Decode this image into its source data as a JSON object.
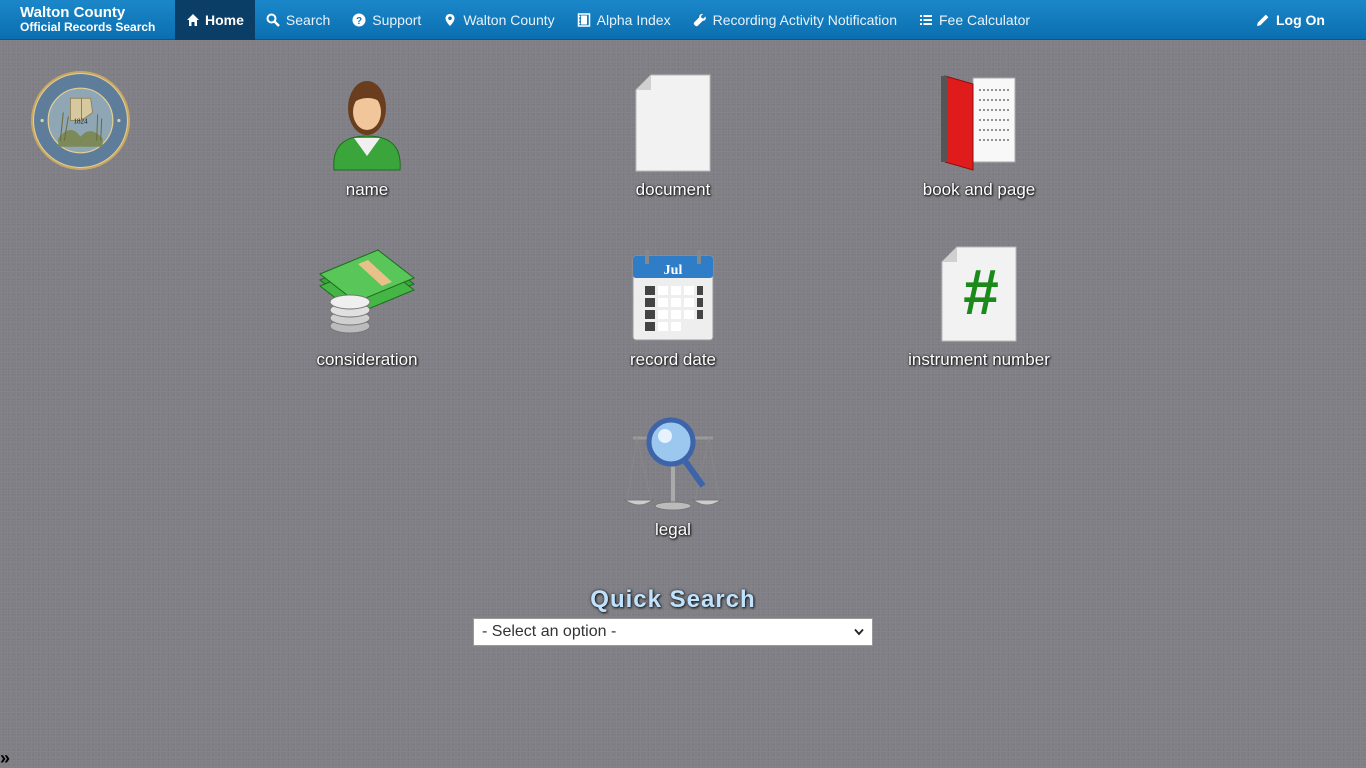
{
  "brand": {
    "line1": "Walton County",
    "line2": "Official Records Search"
  },
  "nav": {
    "home": "Home",
    "search": "Search",
    "support": "Support",
    "county": "Walton County",
    "alpha": "Alpha Index",
    "recording": "Recording Activity Notification",
    "fee": "Fee Calculator",
    "logon": "Log On"
  },
  "seal": {
    "text_top": "Clerk of Courts & County Comptroller",
    "year": "1824",
    "text_bottom": "Walton County, Florida"
  },
  "tiles": {
    "name": "name",
    "document": "document",
    "book_page": "book and page",
    "consideration": "consideration",
    "record_date": "record date",
    "instrument": "instrument number",
    "legal": "legal"
  },
  "calendar": {
    "month": "Jul"
  },
  "instrument_symbol": "#",
  "quick_search": {
    "title": "Quick Search",
    "selected": "- Select an option -"
  },
  "footer": {
    "toggle": "»"
  },
  "colors": {
    "navbar": "#1b87c9",
    "active": "#0a3e66",
    "quick_title": "#bfe3ff"
  }
}
